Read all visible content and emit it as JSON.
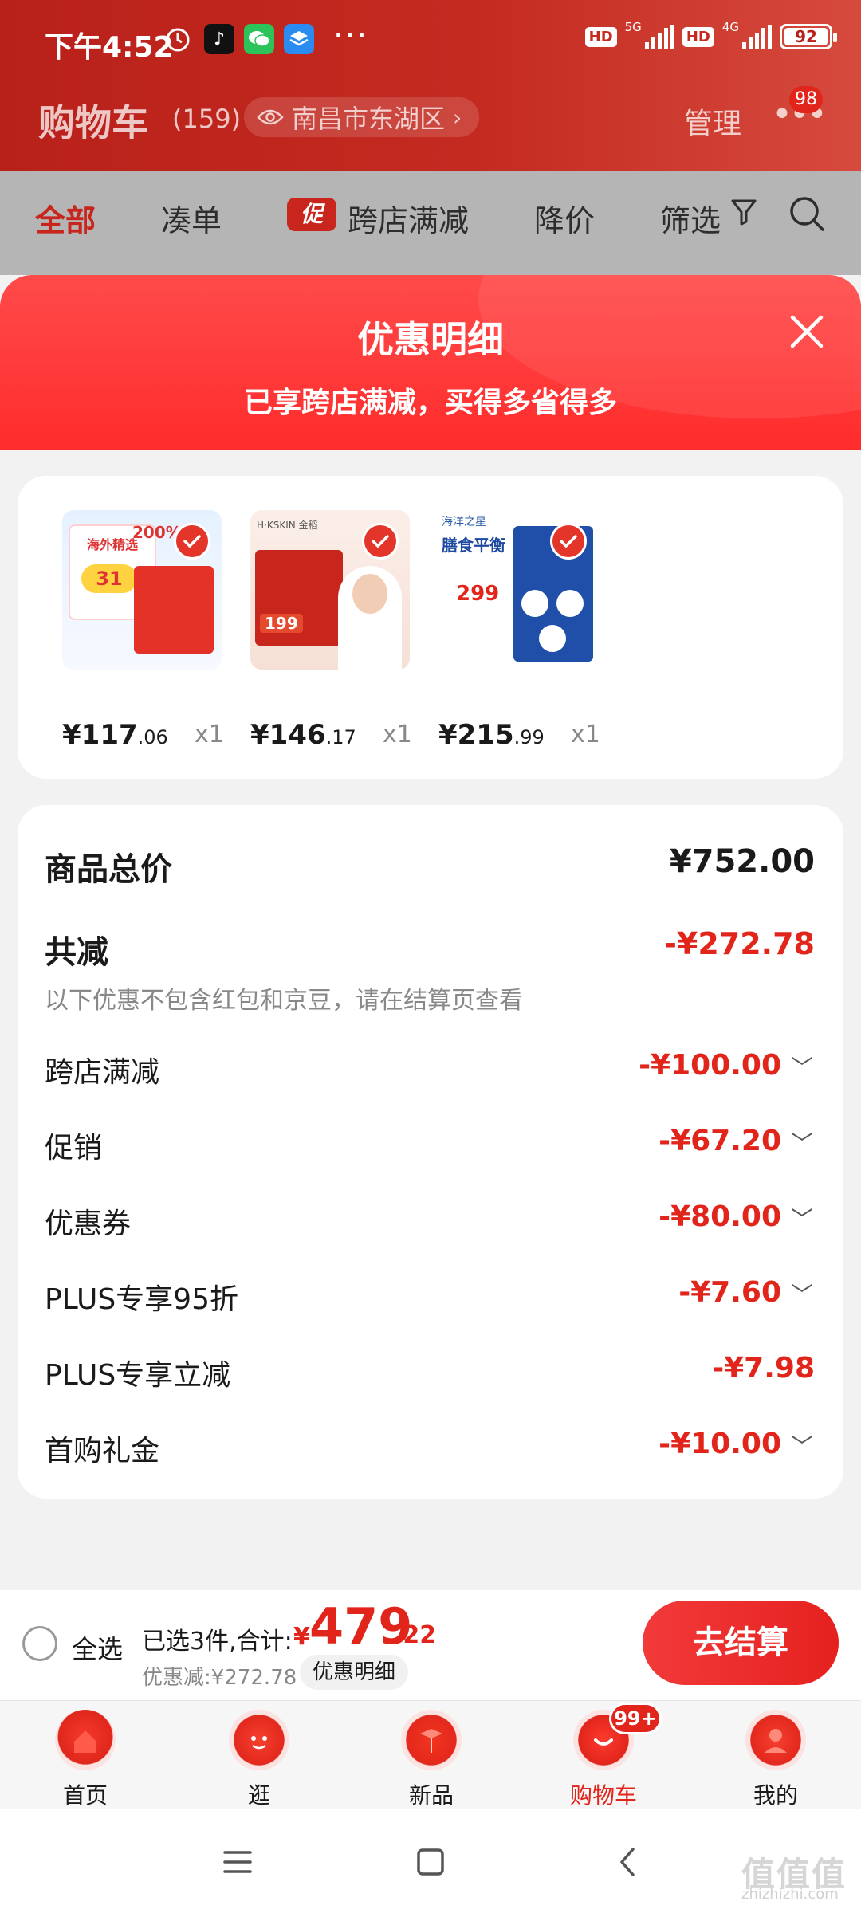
{
  "status_bar": {
    "time": "下午4:52",
    "more": "···",
    "hd1": "HD",
    "net1": "5G",
    "hd2": "HD",
    "net2": "4G",
    "battery": "92"
  },
  "header": {
    "title": "购物车",
    "count": "(159)",
    "location": "南昌市东湖区",
    "manage": "管理",
    "more_badge": "98"
  },
  "filter_tabs": {
    "all": "全部",
    "combine": "凑单",
    "promo_tag": "促",
    "cross_store": "跨店满减",
    "price_drop": "降价",
    "filter": "筛选"
  },
  "modal": {
    "title": "优惠明细",
    "subtitle": "已享跨店满减，买得多省得多"
  },
  "products": [
    {
      "price_int": "¥117",
      "price_dec": ".06",
      "qty": "x1"
    },
    {
      "price_int": "¥146",
      "price_dec": ".17",
      "qty": "x1"
    },
    {
      "price_int": "¥215",
      "price_dec": ".99",
      "qty": "x1"
    }
  ],
  "product_image_text": {
    "p1_a": "海外精选",
    "p1_b": "200%",
    "p1_c": "31",
    "p2_brand": "H·KSKIN 金稻",
    "p2_price": "199",
    "p3_brand": "海洋之星",
    "p3_title": "膳食平衡",
    "p3_price": "299"
  },
  "summary": {
    "total_label": "商品总价",
    "total_value": "¥752.00",
    "reduce_label": "共减",
    "reduce_value": "-¥272.78",
    "note": "以下优惠不包含红包和京豆，请在结算页查看",
    "rows": [
      {
        "label": "跨店满减",
        "value": "-¥100.00"
      },
      {
        "label": "促销",
        "value": "-¥67.20"
      },
      {
        "label": "优惠券",
        "value": "-¥80.00"
      },
      {
        "label": "PLUS专享95折",
        "value": "-¥7.60"
      },
      {
        "label": "PLUS专享立减",
        "value": "-¥7.98"
      },
      {
        "label": "首购礼金",
        "value": "-¥10.00"
      }
    ]
  },
  "checkout": {
    "select_all": "全选",
    "selected_info": "已选3件,合计:",
    "yen": "¥",
    "total_int": "479",
    "total_dec": ".22",
    "discount_info": "优惠减:¥272.78",
    "detail_label": "优惠明细",
    "button": "去结算"
  },
  "tabs": [
    {
      "label": "首页"
    },
    {
      "label": "逛"
    },
    {
      "label": "新品"
    },
    {
      "label": "购物车"
    },
    {
      "label": "我的"
    }
  ],
  "cart_badge": "99+",
  "watermark": {
    "main": "值值值",
    "sub": "zhizhizhi.com"
  },
  "colors": {
    "accent": "#e1251b",
    "header_red": "#c42a20",
    "modal_red": "#ff3333"
  }
}
